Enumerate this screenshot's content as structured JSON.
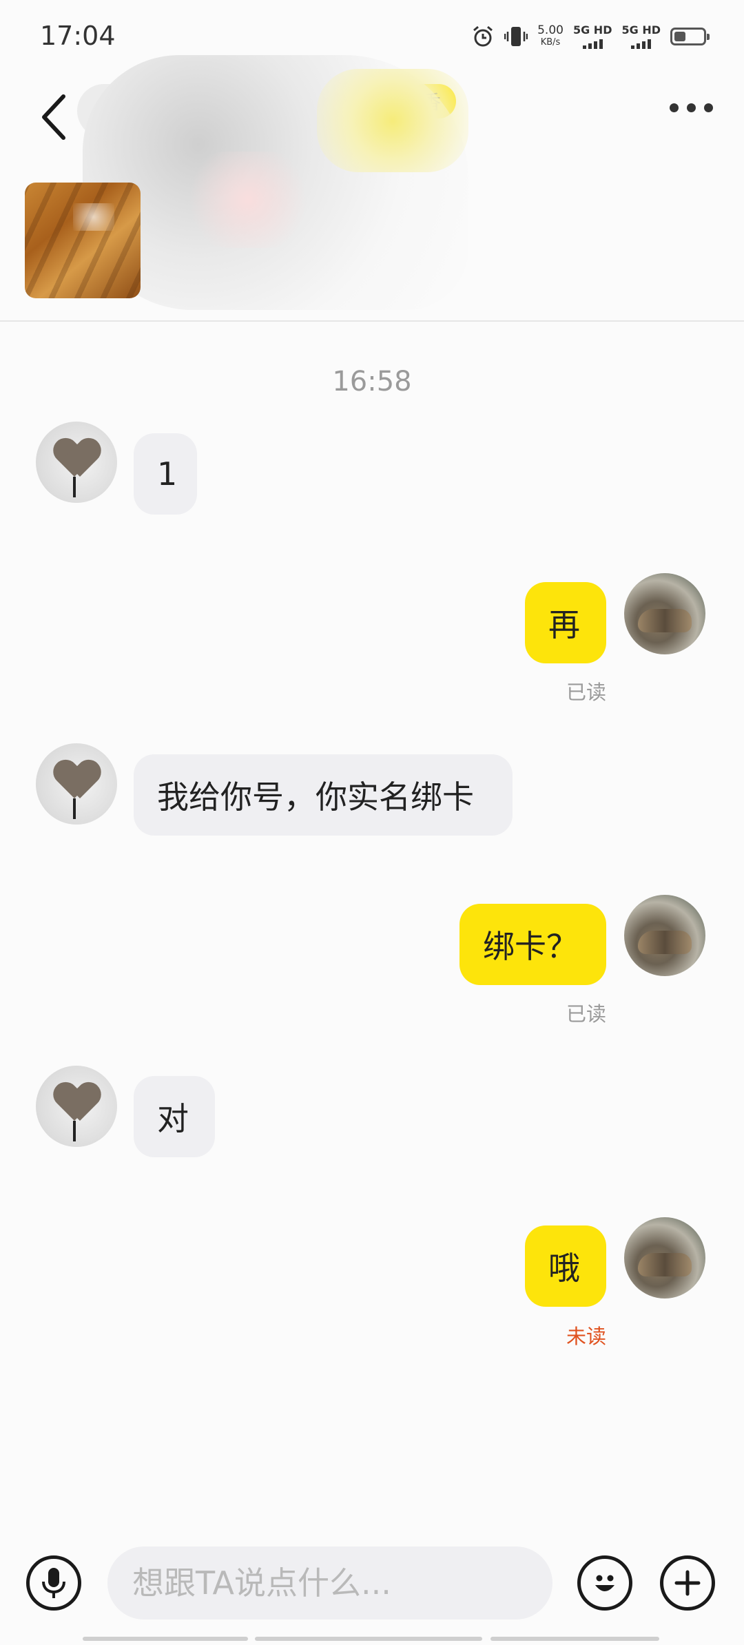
{
  "status_bar": {
    "time": "17:04",
    "net_speed_value": "5.00",
    "net_speed_unit": "KB/s",
    "sim1_label": "5G HD",
    "sim2_label": "5G HD",
    "battery_level": 0.4,
    "icons": [
      "alarm-icon",
      "vibrate-icon",
      "signal-icon",
      "battery-icon"
    ]
  },
  "header": {
    "title_visible": "3",
    "badge_visible": "香",
    "more_label": "more"
  },
  "chat": {
    "timestamp": "16:58",
    "messages": [
      {
        "from": "other",
        "text": "1"
      },
      {
        "from": "self",
        "text": "再",
        "status": "已读"
      },
      {
        "from": "other",
        "text": "我给你号，你实名绑卡"
      },
      {
        "from": "self",
        "text": "绑卡？",
        "status": "已读"
      },
      {
        "from": "other",
        "text": "对"
      },
      {
        "from": "self",
        "text": "哦",
        "status": "未读"
      }
    ]
  },
  "input_bar": {
    "placeholder": "想跟TA说点什么...",
    "value": ""
  },
  "colors": {
    "accent_yellow": "#fde40b",
    "unread_red": "#e0521f",
    "bubble_other": "#efeff2"
  }
}
